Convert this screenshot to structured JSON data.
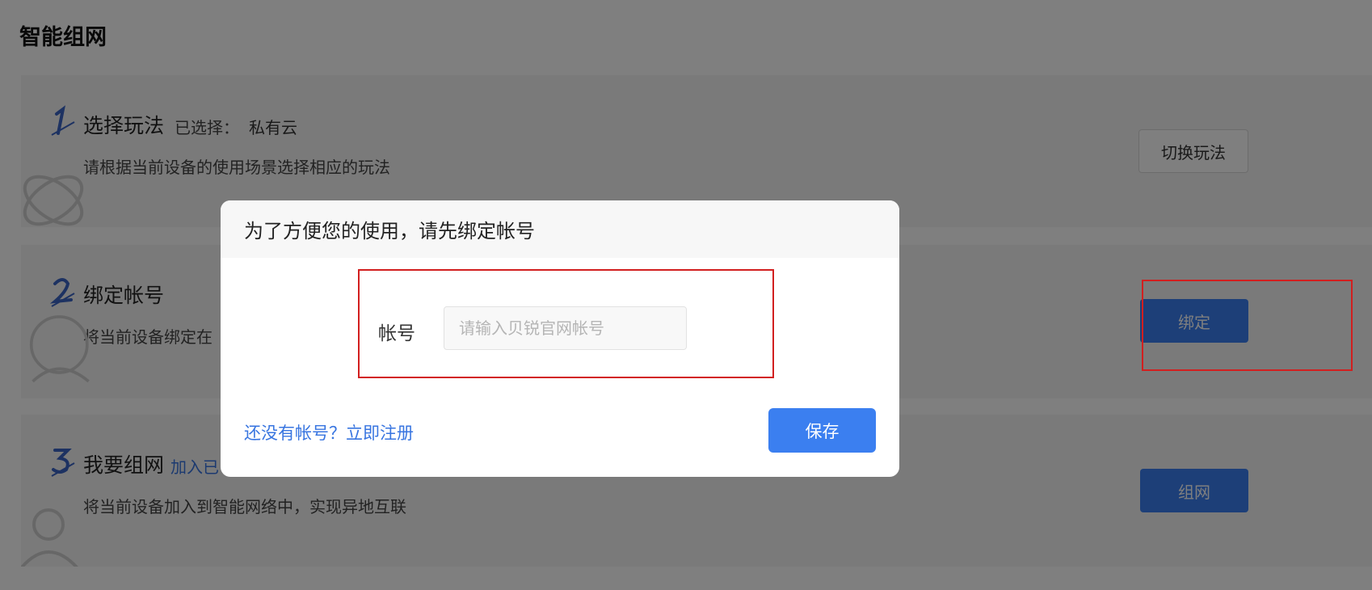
{
  "page": {
    "title": "智能组网"
  },
  "steps": [
    {
      "number": "1",
      "title": "选择玩法",
      "selected_label": "已选择：",
      "selected_value": "私有云",
      "desc": "请根据当前设备的使用场景选择相应的玩法",
      "button_label": "切换玩法"
    },
    {
      "number": "2",
      "title": "绑定帐号",
      "desc": "将当前设备绑定在",
      "button_label": "绑定"
    },
    {
      "number": "3",
      "title": "我要组网",
      "link_text": "加入已",
      "desc": "将当前设备加入到智能网络中，实现异地互联",
      "button_label": "组网"
    }
  ],
  "modal": {
    "title": "为了方便您的使用，请先绑定帐号",
    "account_label": "帐号",
    "account_placeholder": "请输入贝锐官网帐号",
    "account_value": "",
    "register_link": "还没有帐号？立即注册",
    "save_label": "保存"
  },
  "colors": {
    "accent": "#3b7ff0",
    "link": "#3875e0",
    "highlight": "#d21f1f",
    "overlay": "rgba(0,0,0,0.5)"
  },
  "icons": [
    "step-1-icon",
    "step-2-icon",
    "step-3-icon",
    "orbit-icon",
    "user-icon",
    "person-icon"
  ]
}
